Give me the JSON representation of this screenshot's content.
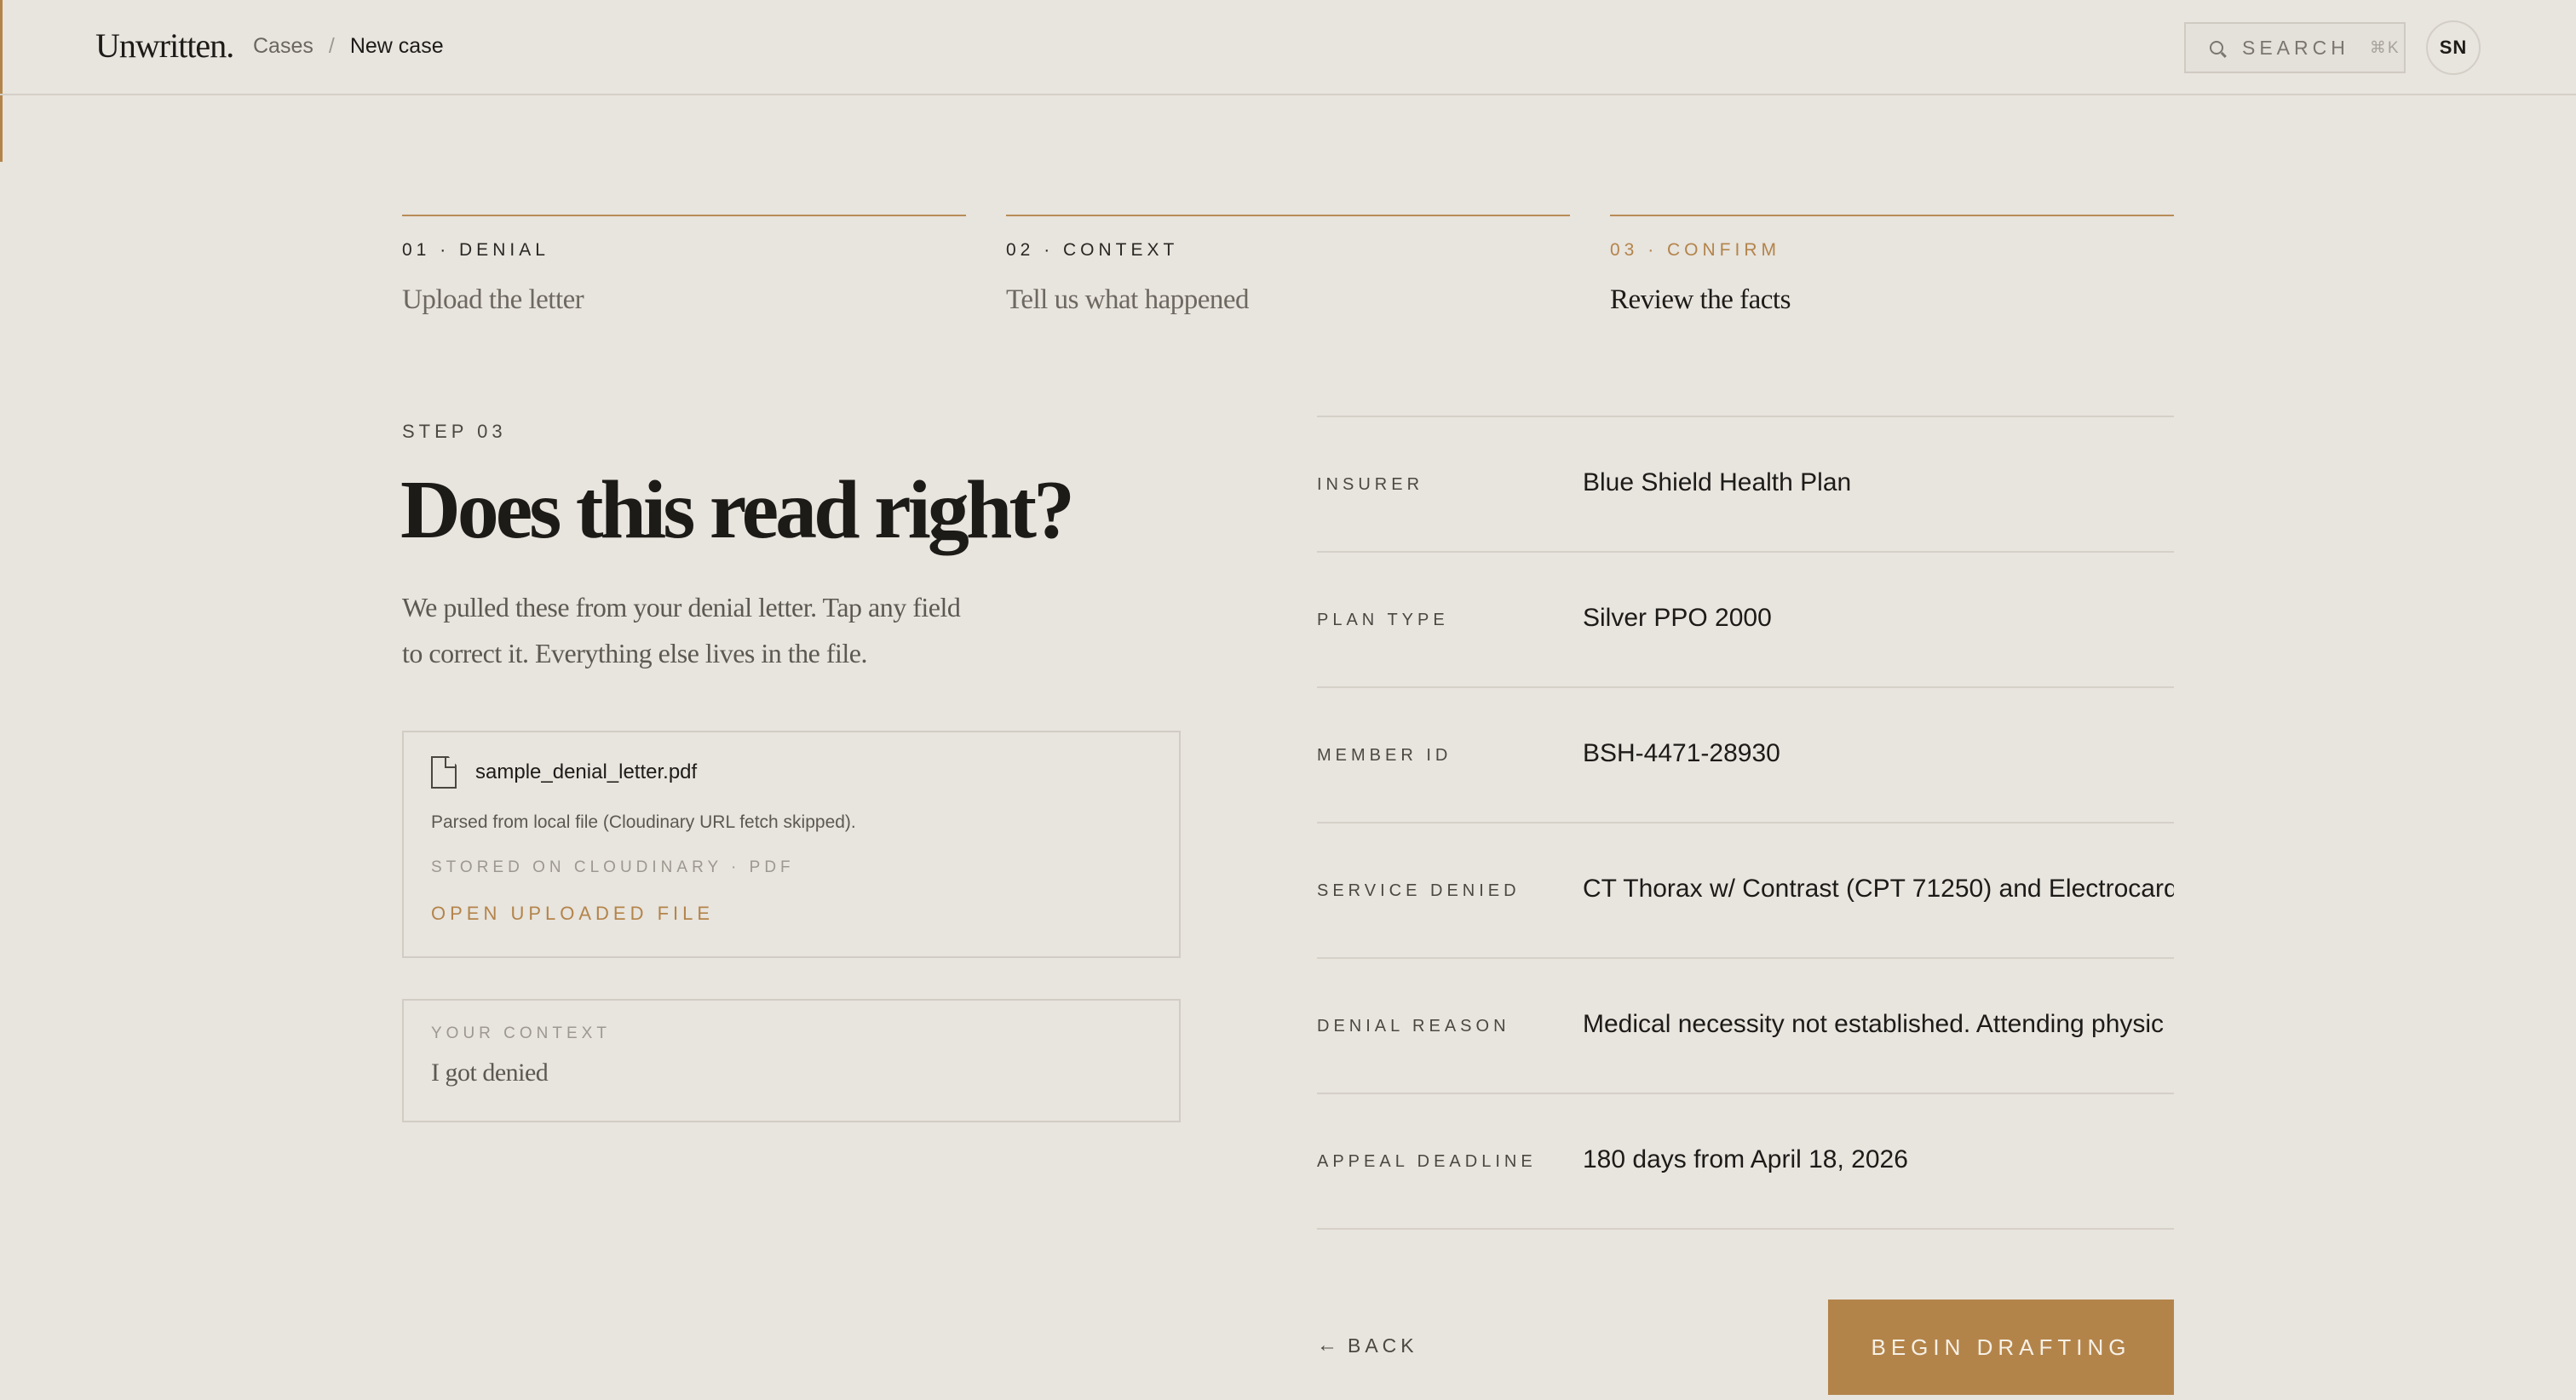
{
  "header": {
    "logo": "Unwritten.",
    "breadcrumb": {
      "parent": "Cases",
      "separator": "/",
      "current": "New case"
    },
    "search": {
      "label": "SEARCH",
      "shortcut": "⌘K"
    },
    "avatar_initials": "SN"
  },
  "steps": [
    {
      "label": "01 · DENIAL",
      "title": "Upload the letter",
      "active": false
    },
    {
      "label": "02 · CONTEXT",
      "title": "Tell us what happened",
      "active": false
    },
    {
      "label": "03 · CONFIRM",
      "title": "Review the facts",
      "active": true
    }
  ],
  "main": {
    "eyebrow": "STEP 03",
    "heading": "Does this read right?",
    "lede": "We pulled these from your denial letter. Tap any field to correct it. Everything else lives in the file."
  },
  "file": {
    "name": "sample_denial_letter.pdf",
    "note": "Parsed from local file (Cloudinary URL fetch skipped).",
    "stored": "STORED ON CLOUDINARY · PDF",
    "open_label": "OPEN UPLOADED FILE"
  },
  "context": {
    "label": "YOUR CONTEXT",
    "value": "I got denied"
  },
  "fields": [
    {
      "label": "INSURER",
      "value": "Blue Shield Health Plan"
    },
    {
      "label": "PLAN TYPE",
      "value": "Silver PPO 2000"
    },
    {
      "label": "MEMBER ID",
      "value": "BSH-4471-28930"
    },
    {
      "label": "SERVICE DENIED",
      "value": "CT Thorax w/ Contrast (CPT 71250) and Electrocard"
    },
    {
      "label": "DENIAL REASON",
      "value": "Medical necessity not established. Attending physic"
    },
    {
      "label": "APPEAL DEADLINE",
      "value": "180 days from April 18, 2026"
    }
  ],
  "actions": {
    "back_label": "BACK",
    "back_arrow": "←",
    "primary_label": "BEGIN DRAFTING"
  },
  "colors": {
    "accent": "#b3844a",
    "background": "#e8e4de",
    "text": "#1d1b18"
  }
}
